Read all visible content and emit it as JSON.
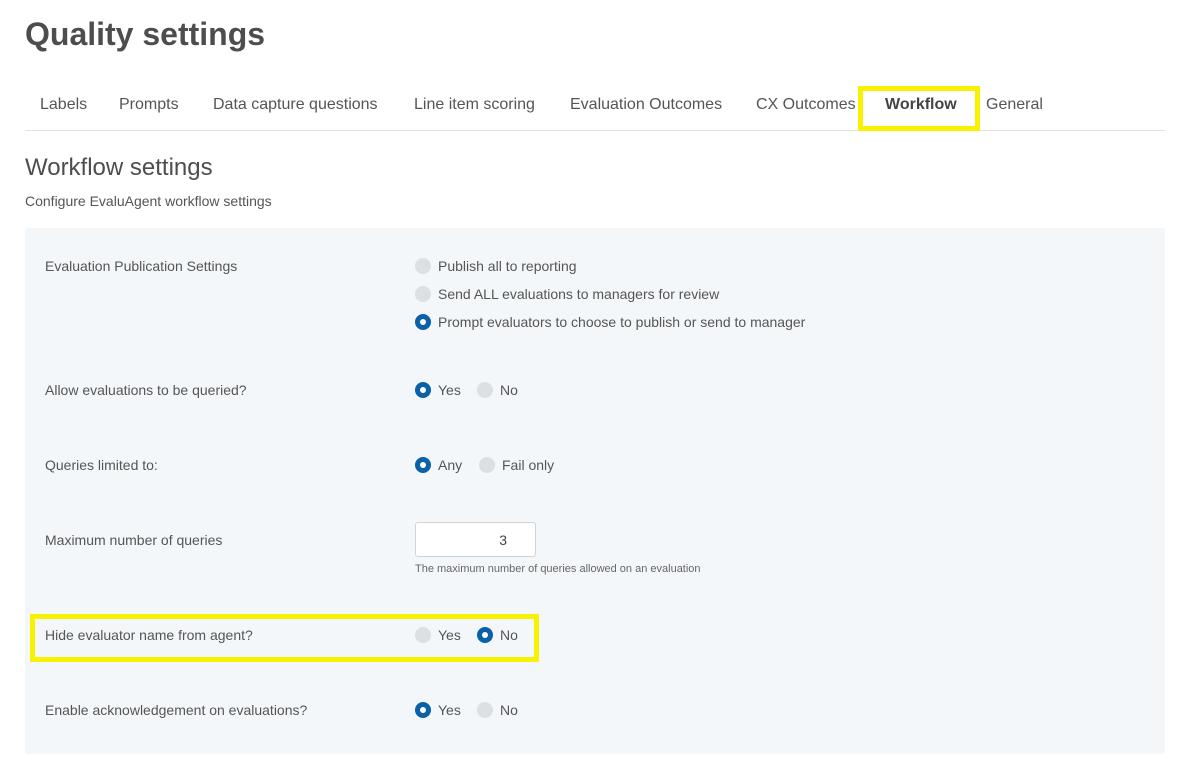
{
  "page": {
    "title": "Quality settings"
  },
  "tabs": [
    {
      "label": "Labels"
    },
    {
      "label": "Prompts"
    },
    {
      "label": "Data capture questions"
    },
    {
      "label": "Line item scoring"
    },
    {
      "label": "Evaluation Outcomes"
    },
    {
      "label": "CX Outcomes"
    },
    {
      "label": "Workflow",
      "active": true
    },
    {
      "label": "General"
    }
  ],
  "section": {
    "title": "Workflow settings",
    "subtitle": "Configure EvaluAgent workflow settings"
  },
  "settings": {
    "publication": {
      "label": "Evaluation Publication Settings",
      "options": [
        "Publish all to reporting",
        "Send ALL evaluations to managers for review",
        "Prompt evaluators to choose to publish or send to manager"
      ],
      "selected": 2
    },
    "allow_queries": {
      "label": "Allow evaluations to be queried?",
      "options": [
        "Yes",
        "No"
      ],
      "selected": 0
    },
    "queries_limited": {
      "label": "Queries limited to:",
      "options": [
        "Any",
        "Fail only"
      ],
      "selected": 0
    },
    "max_queries": {
      "label": "Maximum number of queries",
      "value": "3",
      "hint": "The maximum number of queries allowed on an evaluation"
    },
    "hide_evaluator": {
      "label": "Hide evaluator name from agent?",
      "options": [
        "Yes",
        "No"
      ],
      "selected": 1
    },
    "acknowledgement": {
      "label": "Enable acknowledgement on evaluations?",
      "options": [
        "Yes",
        "No"
      ],
      "selected": 0
    }
  },
  "colors": {
    "accent": "#0a61a7",
    "highlight": "#f8f100",
    "panel_bg": "#f4f7fa"
  }
}
